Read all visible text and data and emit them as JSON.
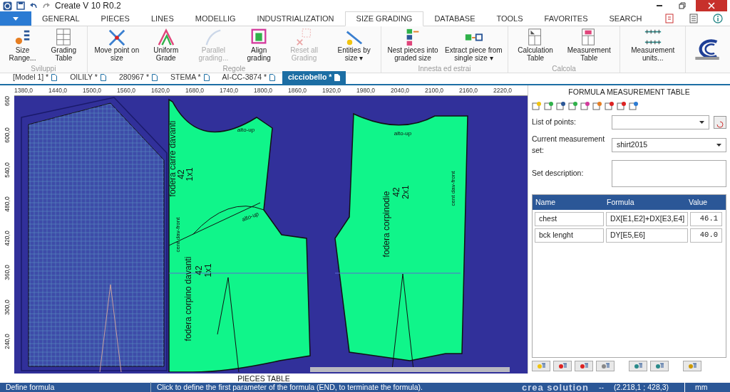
{
  "window": {
    "title": "Create V 10 R0.2"
  },
  "ribbon_tabs": [
    {
      "label": "GENERAL",
      "selected": false
    },
    {
      "label": "PIECES",
      "selected": false
    },
    {
      "label": "LINES",
      "selected": false
    },
    {
      "label": "MODELLIG",
      "selected": false
    },
    {
      "label": "INDUSTRIALIZATION",
      "selected": false
    },
    {
      "label": "SIZE GRADING",
      "selected": true
    },
    {
      "label": "DATABASE",
      "selected": false
    },
    {
      "label": "TOOLS",
      "selected": false
    },
    {
      "label": "FAVORITES",
      "selected": false
    },
    {
      "label": "SEARCH",
      "selected": false
    }
  ],
  "ribbon_groups": [
    {
      "label": "Sviluppi",
      "buttons": [
        {
          "label": "Size Range...",
          "disabled": false
        },
        {
          "label": "Grading Table",
          "disabled": false
        }
      ]
    },
    {
      "label": "Regole",
      "buttons": [
        {
          "label": "Move point on size",
          "disabled": false
        },
        {
          "label": "Uniform Grade",
          "disabled": false
        },
        {
          "label": "Parallel grading...",
          "disabled": true
        },
        {
          "label": "Align grading",
          "disabled": false
        },
        {
          "label": "Reset all Grading",
          "disabled": true
        },
        {
          "label": "Entities by size ▾",
          "disabled": false
        }
      ]
    },
    {
      "label": "Innesta ed estrai",
      "buttons": [
        {
          "label": "Nest pieces into graded size",
          "disabled": false
        },
        {
          "label": "Extract piece from single size ▾",
          "disabled": false
        }
      ]
    },
    {
      "label": "Calcola",
      "buttons": [
        {
          "label": "Calculation Table",
          "disabled": false
        },
        {
          "label": "Measurement Table",
          "disabled": false
        }
      ]
    },
    {
      "buttons": [
        {
          "label": "Measurement units...",
          "disabled": false
        }
      ]
    }
  ],
  "document_tabs": [
    {
      "label": "[Model 1] *",
      "selected": false
    },
    {
      "label": "OILILY *",
      "selected": false
    },
    {
      "label": "280967 *",
      "selected": false
    },
    {
      "label": "STEMA *",
      "selected": false
    },
    {
      "label": "AI-CC-3874 *",
      "selected": false
    },
    {
      "label": "cicciobello *",
      "selected": true
    }
  ],
  "ruler": {
    "x_labels": [
      "1380,0",
      "1440,0",
      "1500,0",
      "1560,0",
      "1620,0",
      "1680,0",
      "1740,0",
      "1800,0",
      "1860,0",
      "1920,0",
      "1980,0",
      "2040,0",
      "2100,0",
      "2160,0",
      "2220,0"
    ],
    "y_labels": [
      "660",
      "600,0",
      "540,0",
      "480,0",
      "420,0",
      "360,0",
      "300,0",
      "240,0"
    ]
  },
  "canvas_labels": [
    {
      "text": "fodera carre davanti",
      "kind": "big"
    },
    {
      "text": "42",
      "kind": "big"
    },
    {
      "text": "1x1",
      "kind": "big"
    },
    {
      "text": "fodera corpino davanti",
      "kind": "big"
    },
    {
      "text": "42",
      "kind": "big"
    },
    {
      "text": "1x1",
      "kind": "big"
    },
    {
      "text": "fodera corpinodie",
      "kind": "big"
    },
    {
      "text": "42",
      "kind": "big"
    },
    {
      "text": "2x1",
      "kind": "big"
    },
    {
      "text": "alto-up",
      "kind": "small"
    },
    {
      "text": "alto-up",
      "kind": "small"
    },
    {
      "text": "alto-up",
      "kind": "small"
    },
    {
      "text": "cent dav-front",
      "kind": "small"
    },
    {
      "text": "cent dav-front",
      "kind": "small"
    }
  ],
  "panel": {
    "title": "FORMULA MEASUREMENT TABLE",
    "list_of_points": {
      "label": "List of points:"
    },
    "measurement_set": {
      "label": "Current measurement set:",
      "value": "shirt2015"
    },
    "set_description": {
      "label": "Set description:"
    },
    "table": {
      "columns": [
        "Name",
        "Formula",
        "Value"
      ],
      "rows": [
        {
          "name": "chest",
          "formula": "DX[E1,E2]+DX[E3,E4]",
          "value": "46.1"
        },
        {
          "name": "bck lenght",
          "formula": "DY[E5,E6]",
          "value": "40.0"
        }
      ]
    }
  },
  "pieces_table": {
    "title": "PIECES TABLE"
  },
  "status_bar": {
    "mode": "Define formula",
    "hint": "Click to define the first parameter of the formula (END, to terminate the formula).",
    "brand": "crea solution",
    "separator": "--",
    "coordinates": "(2.218,1 ; 428,3)",
    "units": "mm"
  }
}
